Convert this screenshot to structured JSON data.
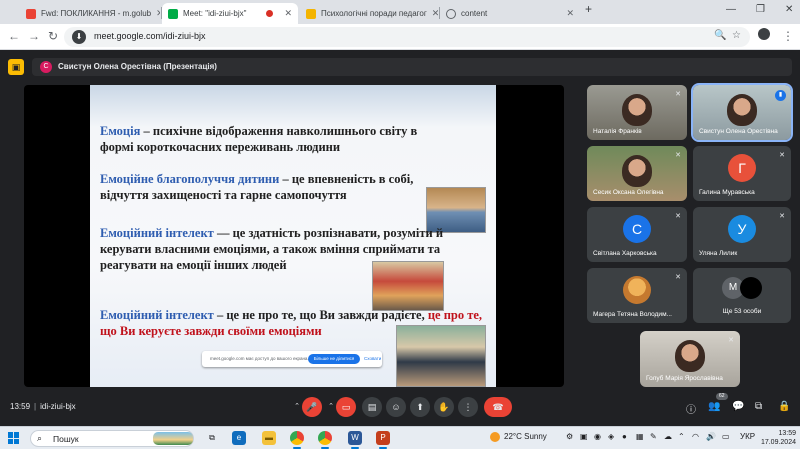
{
  "browser": {
    "tabs": [
      {
        "title": "Fwd: ПОКЛИКАННЯ - m.golub",
        "favicon": "gmail-icon",
        "color": "#ea4335"
      },
      {
        "title": "Meet: \"idi-ziui-bjx\"",
        "favicon": "meet-icon",
        "color": "#00ac47",
        "active": true,
        "recording": true
      },
      {
        "title": "Психологічні поради педагог",
        "favicon": "page-icon",
        "color": "#f4b400"
      },
      {
        "title": "content",
        "favicon": "globe-icon",
        "color": "#5f6368"
      }
    ],
    "new_tab": "+",
    "window_controls": {
      "minimize": "—",
      "restore": "❐",
      "close": "✕"
    },
    "url": "meet.google.com/idi-ziui-bjx",
    "nav": {
      "back": "←",
      "forward": "→",
      "reload": "↻"
    }
  },
  "meet": {
    "presenter_banner": "Свистун Олена Орестівна (Презентація)",
    "presenter_initial": "С",
    "slide": {
      "p1_term": "Емоція",
      "p1_rest": " – психічне відображення навколишнього світу в формі короткочасних переживань людини",
      "p2_term": "Емоційне благополуччя дитини",
      "p2_rest": " – це впевненість в собі, відчуття захищеності та гарне самопочуття",
      "p3_term": "Емоційний інтелект",
      "p3_rest": " — це здатність розпізнавати, розуміти й керувати власними емоціями, а також вміння сприймати та реагувати на емоції інших людей",
      "p4_term": "Емоційний інтелект",
      "p4_mid": " – це не про те, що Ви завжди радієте, ",
      "p4_red": "це про те, що Ви керуєте завжди своїми емоціями"
    },
    "share_toast": {
      "text": "meet.google.com має доступ до вашого екрана.",
      "stop": "Більше не ділитися",
      "hide": "Сховати"
    },
    "participants": [
      {
        "name": "Наталія Франків",
        "type": "video"
      },
      {
        "name": "Свистун Олена Орестівна",
        "type": "video",
        "speaking": true
      },
      {
        "name": "Сесик Оксана Олегівна",
        "type": "video"
      },
      {
        "name": "Галина Муравська",
        "type": "avatar",
        "initial": "Г",
        "color": "#e8513a"
      },
      {
        "name": "Світлана Харковська",
        "type": "avatar",
        "initial": "С",
        "color": "#1a73e8"
      },
      {
        "name": "Уляна Лилик",
        "type": "avatar",
        "initial": "У",
        "color": "#1a8be0"
      },
      {
        "name": "Магера Тетяна Володим...",
        "type": "avatar-photo"
      },
      {
        "name": "Ще 53 особи",
        "type": "more",
        "initial": "М"
      },
      {
        "name": "Голуб Марія Ярославівна",
        "type": "video"
      }
    ],
    "meeting_time": "13:59",
    "meeting_code": "idi-ziui-bjx",
    "participant_count": "62"
  },
  "taskbar": {
    "search_placeholder": "Пошук",
    "weather_temp": "22°C",
    "weather_text": "Sunny",
    "language": "УКР",
    "time": "13:59",
    "date": "17.09.2024"
  }
}
